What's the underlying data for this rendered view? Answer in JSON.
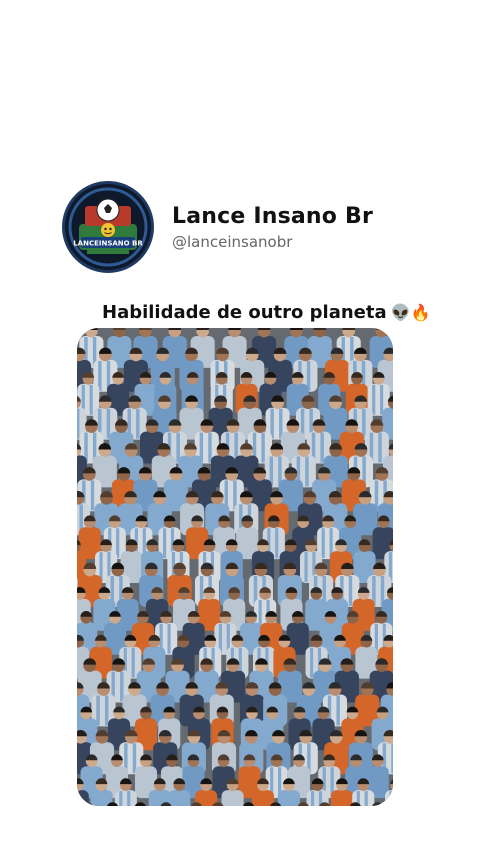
{
  "post": {
    "author": {
      "display_name": "Lance Insano Br",
      "handle": "@lanceinsanobr",
      "avatar_logo_text": "LANCEINSANO BR"
    },
    "caption": {
      "text": "Habilidade de outro planeta",
      "emoji": "👽🔥"
    },
    "media": {
      "type": "video",
      "description_icon": "crowd-video"
    }
  },
  "colors": {
    "background": "#ffffff",
    "text_primary": "#111111",
    "text_secondary": "#666666",
    "avatar_bg": "#0e1a2b",
    "avatar_ring": "#1f3a63",
    "jersey_blue": "#8fb9e0",
    "jersey_white": "#e9eef4"
  }
}
